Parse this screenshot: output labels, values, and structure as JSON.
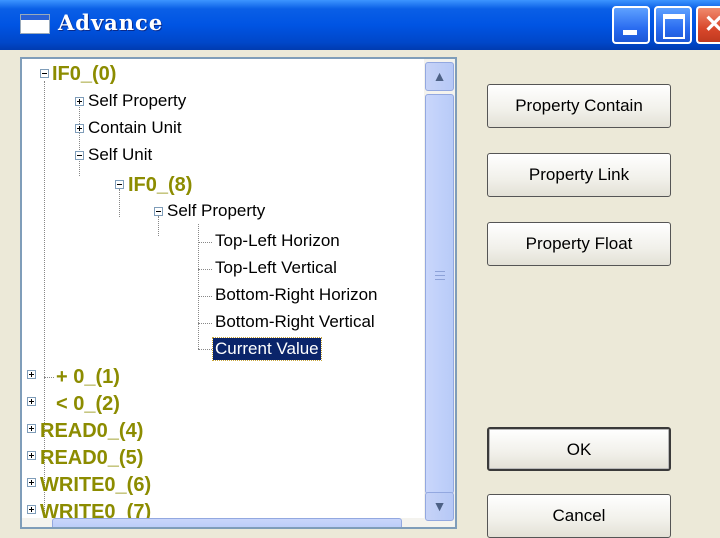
{
  "window": {
    "title": "Advance"
  },
  "tree": {
    "nodes": [
      {
        "id": "if0-0",
        "label": "IF0_(0)",
        "style": "green",
        "expander": "minus"
      },
      {
        "id": "self-property",
        "label": "Self Property",
        "style": "normal",
        "expander": "plus"
      },
      {
        "id": "contain-unit",
        "label": "Contain Unit",
        "style": "normal",
        "expander": "plus"
      },
      {
        "id": "self-unit",
        "label": "Self Unit",
        "style": "normal",
        "expander": "minus"
      },
      {
        "id": "if0-8",
        "label": "IF0_(8)",
        "style": "green",
        "expander": "minus"
      },
      {
        "id": "self-property-2",
        "label": "Self Property",
        "style": "normal",
        "expander": "minus"
      },
      {
        "id": "top-left-horizon",
        "label": "Top-Left Horizon",
        "style": "normal"
      },
      {
        "id": "top-left-vertical",
        "label": "Top-Left Vertical",
        "style": "normal"
      },
      {
        "id": "bottom-right-horizon",
        "label": "Bottom-Right Horizon",
        "style": "normal"
      },
      {
        "id": "bottom-right-vertical",
        "label": "Bottom-Right Vertical",
        "style": "normal"
      },
      {
        "id": "current-value",
        "label": "Current Value",
        "style": "selected"
      },
      {
        "id": "plus-0-1",
        "label": "+ 0_(1)",
        "style": "green",
        "expander": "plus"
      },
      {
        "id": "lt-0-2",
        "label": "< 0_(2)",
        "style": "green",
        "expander": "plus"
      },
      {
        "id": "read0-4",
        "label": "READ0_(4)",
        "style": "green",
        "expander": "plus"
      },
      {
        "id": "read0-5",
        "label": "READ0_(5)",
        "style": "green",
        "expander": "plus"
      },
      {
        "id": "write0-6",
        "label": "WRITE0_(6)",
        "style": "green",
        "expander": "plus"
      },
      {
        "id": "write0-7",
        "label": "WRITE0_(7)",
        "style": "green",
        "expander": "plus"
      }
    ],
    "selected": "Current Value"
  },
  "buttons": {
    "property_contain": "Property Contain",
    "property_link": "Property Link",
    "property_float": "Property Float",
    "ok": "OK",
    "cancel": "Cancel"
  },
  "colors": {
    "titlebar": "#0054e3",
    "tree_category": "#8c8c00",
    "selection": "#0a246a",
    "dialog_bg": "#ece9d8"
  },
  "icons": {
    "minimize": "minimize-icon",
    "maximize": "maximize-icon",
    "close": "close-icon",
    "scroll_up": "chevron-up-icon",
    "scroll_down": "chevron-down-icon"
  }
}
